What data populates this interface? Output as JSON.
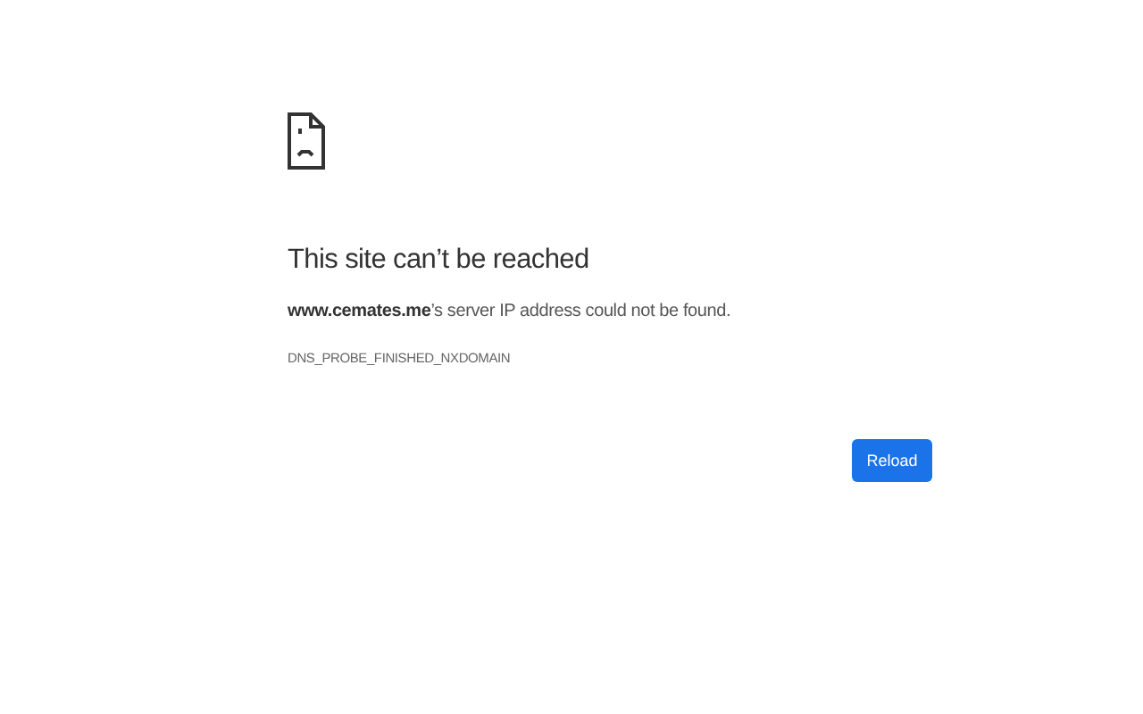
{
  "error": {
    "title": "This site can’t be reached",
    "message": "**www.cemates.me**’s server IP address could not be found.",
    "code": "DNS_PROBE_FINISHED_NXDOMAIN",
    "buttons": [
      "Reload"
    ]
  }
}
